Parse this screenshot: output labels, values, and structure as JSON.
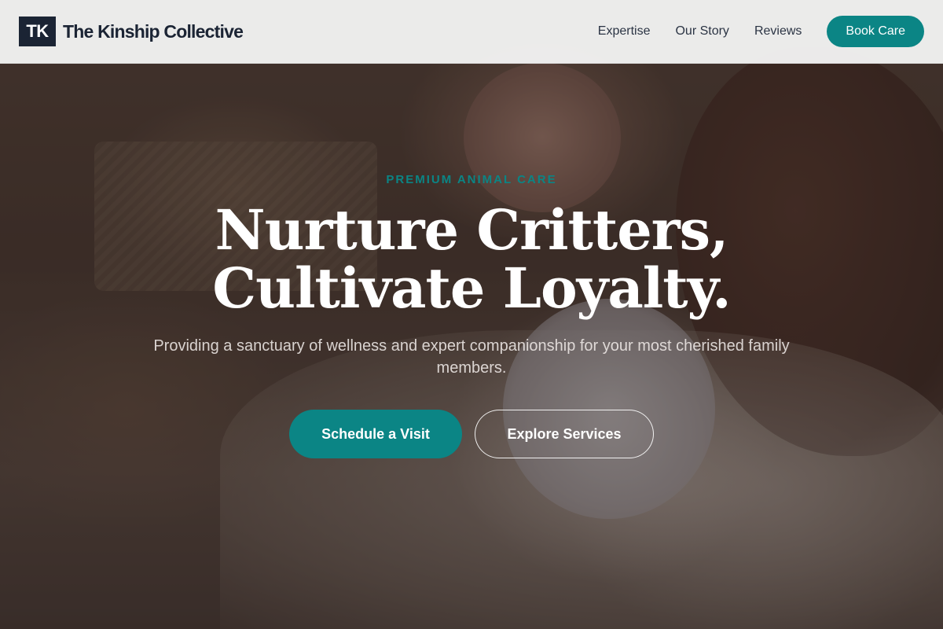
{
  "header": {
    "logo_mark": "TK",
    "brand_name": "The Kinship Collective",
    "nav": [
      {
        "label": "Expertise"
      },
      {
        "label": "Our Story"
      },
      {
        "label": "Reviews"
      }
    ],
    "book_label": "Book Care"
  },
  "hero": {
    "eyebrow": "PREMIUM ANIMAL CARE",
    "headline_line1": "Nurture Critters,",
    "headline_line2": "Cultivate Loyalty.",
    "subtitle": "Providing a sanctuary of wellness and expert companionship for your most cherished family members.",
    "cta_primary": "Schedule a Visit",
    "cta_secondary": "Explore Services"
  },
  "colors": {
    "accent": "#0b8585",
    "brand_dark": "#1b2434",
    "header_bg": "#f3f3f3"
  }
}
